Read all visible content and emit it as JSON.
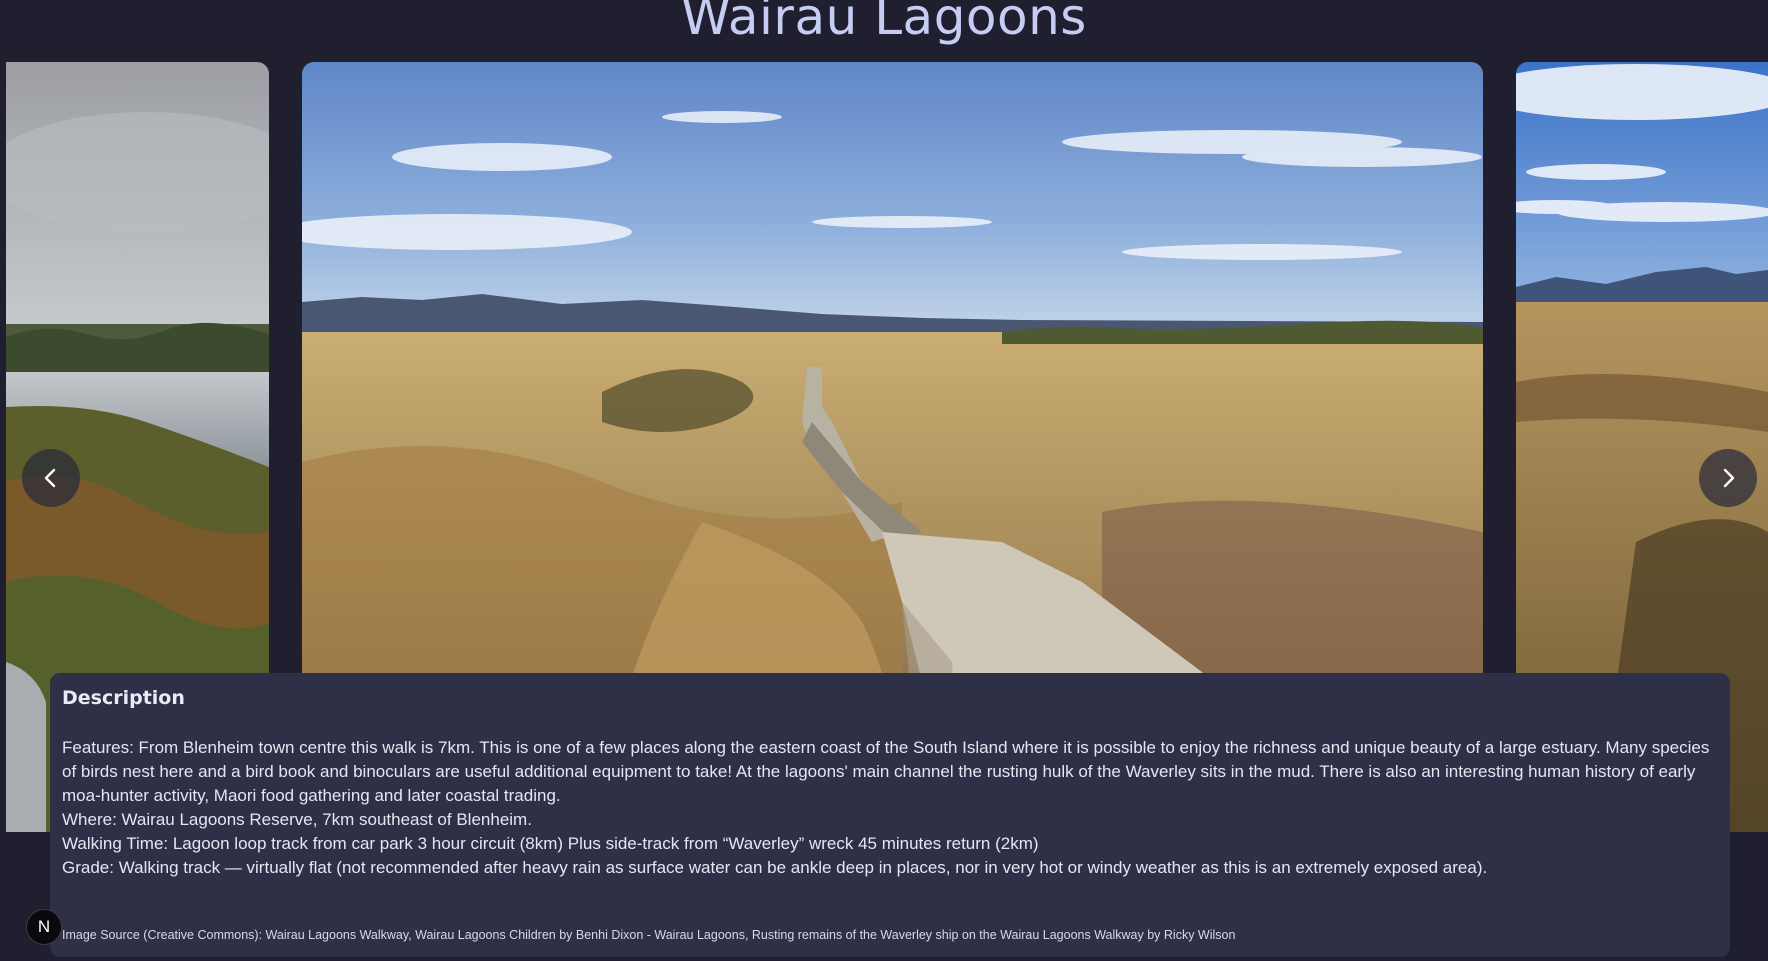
{
  "page": {
    "title": "Wairau Lagoons"
  },
  "carousel": {
    "prev_icon": "chevron-left-icon",
    "next_icon": "chevron-right-icon",
    "slides": [
      {
        "subject": "lagoon channel with reeds under overcast sky"
      },
      {
        "subject": "boardwalk through golden tussock grassland with mountains"
      },
      {
        "subject": "wetland grassland with distant mountain range"
      }
    ]
  },
  "description": {
    "heading": "Description",
    "features": "Features: From Blenheim town centre this walk is 7km. This is one of a few places along the eastern coast of the South Island where it is possible to enjoy the richness and unique beauty of a large estuary. Many species of birds nest here and a bird book and binoculars are useful additional equipment to take! At the lagoons' main channel the rusting hulk of the Waverley sits in the mud. There is also an interesting human history of early moa-hunter activity, Maori food gathering and later coastal trading.",
    "where": "Where: Wairau Lagoons Reserve, 7km southeast of Blenheim.",
    "walking_time": "Walking Time: Lagoon loop track from car park 3 hour circuit (8km) Plus side-track from “Waverley” wreck 45 minutes return (2km)",
    "grade": "Grade: Walking track — virtually flat (not recommended after heavy rain as surface water can be ankle deep in places, nor in very hot or windy weather as this is an extremely exposed area).",
    "source": "Image Source (Creative Commons): Wairau Lagoons Walkway, Wairau Lagoons Children by Benhi Dixon - Wairau Lagoons, Rusting remains of the Waverley ship on the Wairau Lagoons Walkway by Ricky Wilson"
  },
  "badge": {
    "label": "N"
  },
  "colors": {
    "background": "#1f1f30",
    "panel": "#2e3047",
    "title": "#c5cdf2"
  }
}
